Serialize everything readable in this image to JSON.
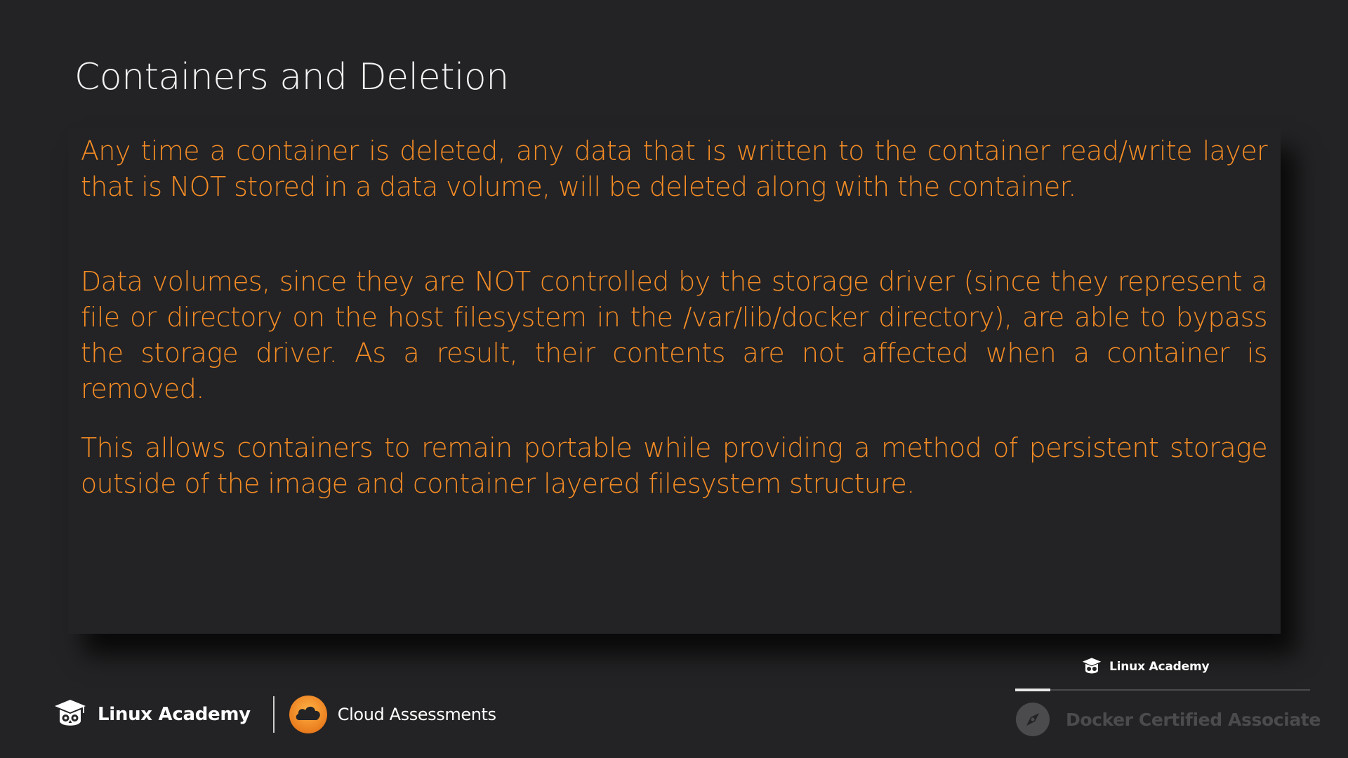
{
  "slide": {
    "title": "Containers and Deletion",
    "paragraphs": [
      "Any time a container is deleted, any data that is written to the container read/write layer that is NOT stored in a data volume, will be deleted along with the container.",
      "Data volumes, since they are NOT controlled by the storage driver (since they represent a file or directory on the host filesystem in the /var/lib/docker directory), are able to bypass the storage driver. As a result, their contents are not affected when a container is removed.",
      "This allows containers to remain portable while providing a method of persistent storage outside of the image and container layered filesystem structure."
    ],
    "text_color": "#f58c25",
    "background_color": "#232325"
  },
  "footer": {
    "brand_name": "Linux Academy",
    "brand_icon": "owl-graduation-cap-icon",
    "partner_name": "Cloud Assessments",
    "partner_icon": "cloud-icon",
    "partner_icon_color": "#f7931e"
  },
  "course": {
    "provider_name": "Linux Academy",
    "provider_icon": "owl-graduation-cap-icon",
    "name": "Docker Certified Associate",
    "icon": "compass-icon",
    "progress": 0.12
  }
}
